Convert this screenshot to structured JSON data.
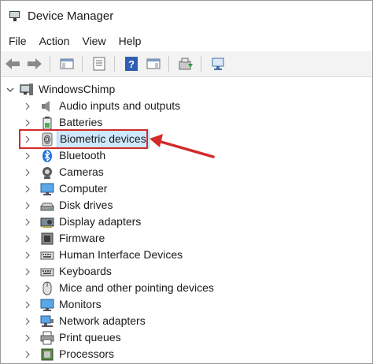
{
  "window": {
    "title": "Device Manager"
  },
  "menu": [
    "File",
    "Action",
    "View",
    "Help"
  ],
  "tree": {
    "root": "WindowsChimp",
    "items": [
      {
        "label": "Audio inputs and outputs",
        "icon": "speaker-icon"
      },
      {
        "label": "Batteries",
        "icon": "battery-icon"
      },
      {
        "label": "Biometric devices",
        "icon": "fingerprint-icon",
        "selected": true
      },
      {
        "label": "Bluetooth",
        "icon": "bluetooth-icon"
      },
      {
        "label": "Cameras",
        "icon": "camera-icon"
      },
      {
        "label": "Computer",
        "icon": "computer-icon"
      },
      {
        "label": "Disk drives",
        "icon": "disk-drive-icon"
      },
      {
        "label": "Display adapters",
        "icon": "display-adapter-icon"
      },
      {
        "label": "Firmware",
        "icon": "firmware-icon"
      },
      {
        "label": "Human Interface Devices",
        "icon": "hid-icon"
      },
      {
        "label": "Keyboards",
        "icon": "keyboard-icon"
      },
      {
        "label": "Mice and other pointing devices",
        "icon": "mouse-icon"
      },
      {
        "label": "Monitors",
        "icon": "monitor-icon"
      },
      {
        "label": "Network adapters",
        "icon": "network-adapter-icon"
      },
      {
        "label": "Print queues",
        "icon": "printer-icon"
      },
      {
        "label": "Processors",
        "icon": "processor-icon"
      }
    ]
  },
  "colors": {
    "annotation": "#d32a2a",
    "selection": "#cde8ff",
    "accent": "#1e6fd9"
  }
}
